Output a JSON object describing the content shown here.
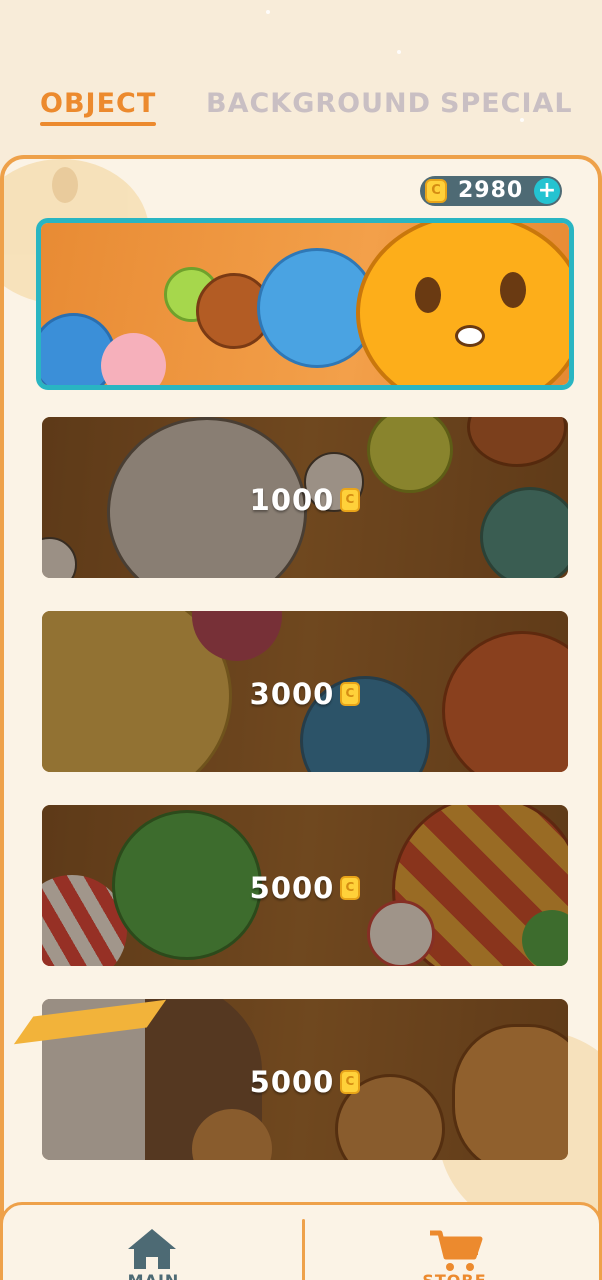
{
  "tabs": {
    "object": "OBJECT",
    "background": "BACKGROUND",
    "special": "SPECIAL",
    "active": "object"
  },
  "wallet": {
    "coins": "2980",
    "coin_icon_letter": "C",
    "add_icon": "plus-icon"
  },
  "object_packs": [
    {
      "name": "fruits-pack",
      "state": "selected",
      "price": ""
    },
    {
      "name": "sports-balls-pack",
      "state": "locked",
      "price": "1000"
    },
    {
      "name": "planets-pack",
      "state": "locked",
      "price": "3000"
    },
    {
      "name": "candy-pack",
      "state": "locked",
      "price": "5000"
    },
    {
      "name": "cats-pack",
      "state": "locked",
      "price": "5000"
    }
  ],
  "nav": {
    "main_label": "MAIN",
    "store_label": "STORE",
    "main_icon": "home-icon",
    "store_icon": "cart-icon"
  },
  "colors": {
    "accent": "#ec8a2e",
    "inactive_tab": "#c9bfc3",
    "selected_border": "#29b5c2",
    "background": "#f8ecd9",
    "coin_pill": "#4e6a74"
  }
}
